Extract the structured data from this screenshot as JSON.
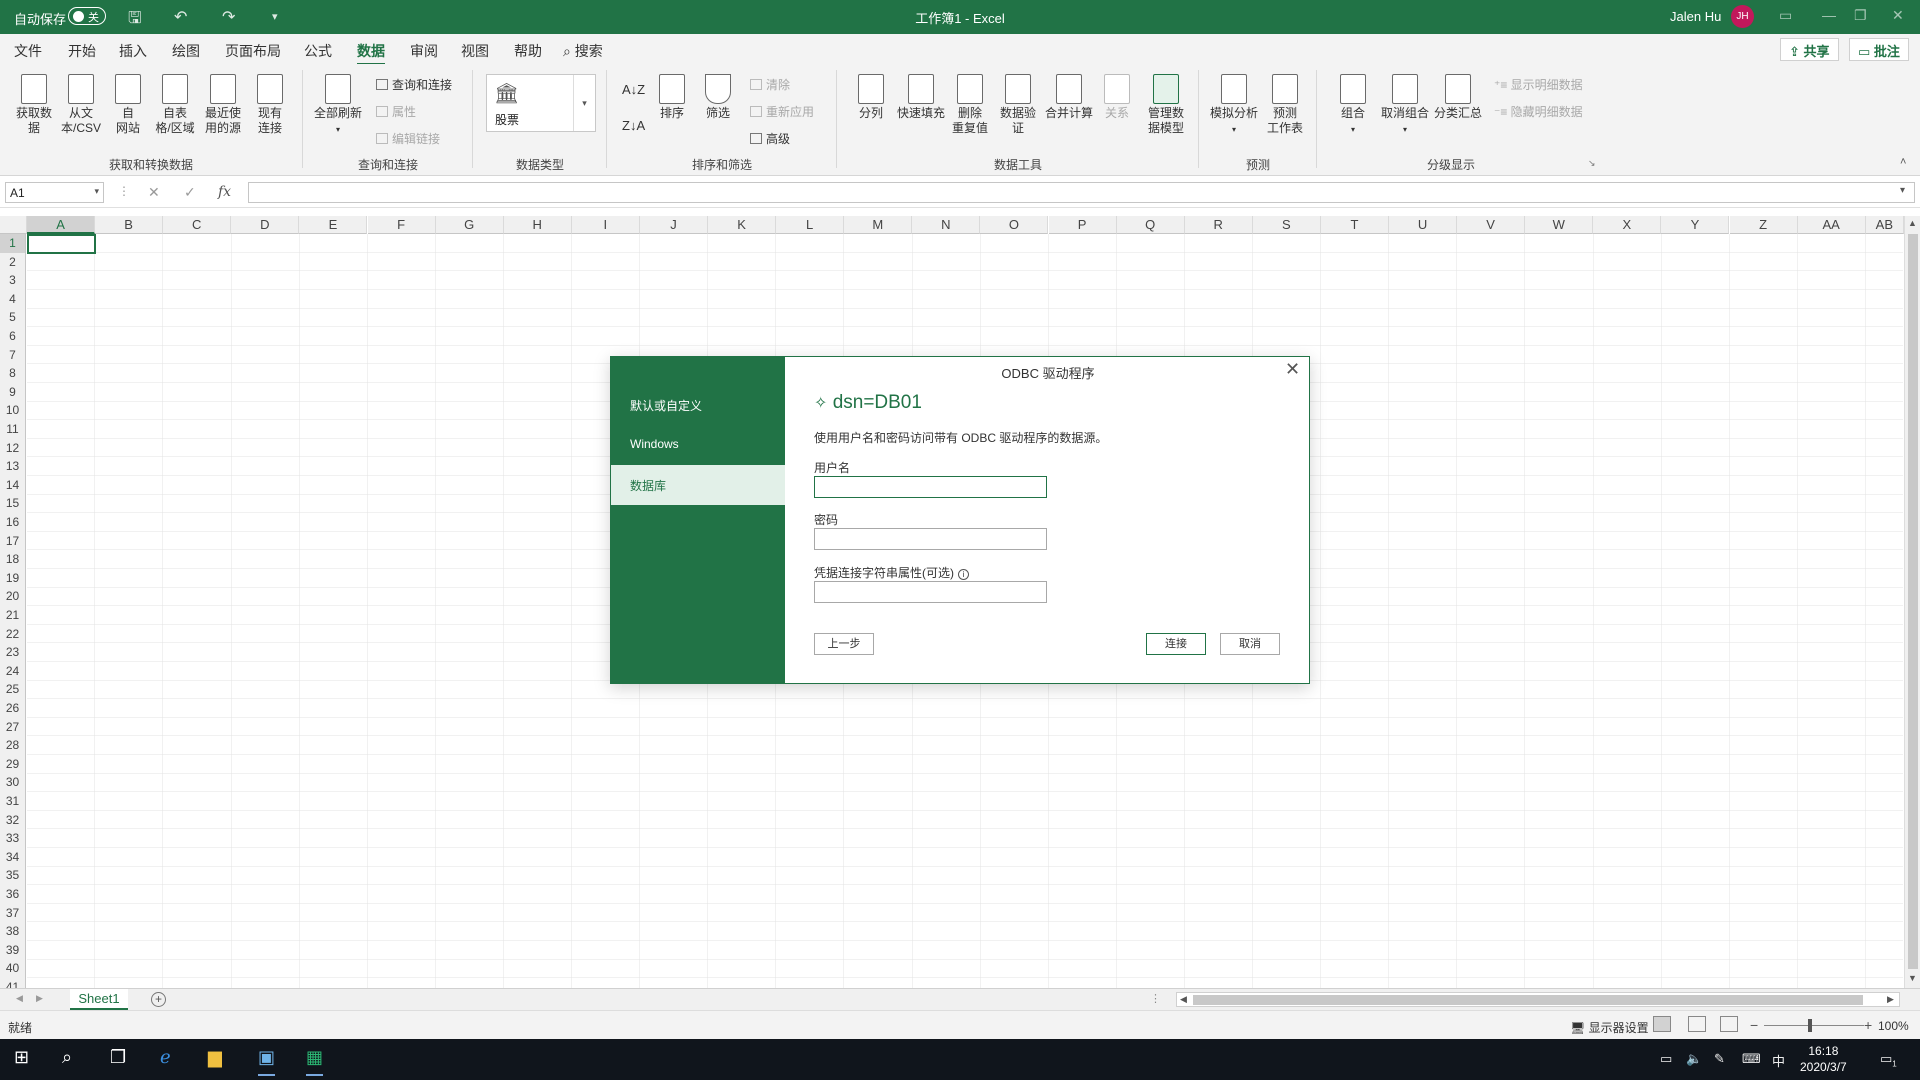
{
  "titlebar": {
    "autosave_label": "自动保存",
    "autosave_state": "关",
    "doc_title": "工作簿1  -  Excel",
    "user_name": "Jalen Hu",
    "avatar_initials": "JH"
  },
  "menu": {
    "items": [
      "文件",
      "开始",
      "插入",
      "绘图",
      "页面布局",
      "公式",
      "数据",
      "审阅",
      "视图",
      "帮助"
    ],
    "active": "数据",
    "search_label": "搜索",
    "share_label": "共享",
    "comment_label": "批注"
  },
  "ribbon": {
    "get_transform": {
      "buttons": [
        "获取数\n据",
        "从文\n本/CSV",
        "自\n网站",
        "自表\n格/区域",
        "最近使\n用的源",
        "现有\n连接"
      ],
      "group_label": "获取和转换数据"
    },
    "queries": {
      "refresh_all": "全部刷新",
      "queries_connections": "查询和连接",
      "properties": "属性",
      "edit_links": "编辑链接",
      "group_label": "查询和连接"
    },
    "data_types": {
      "stocks": "股票",
      "group_label": "数据类型"
    },
    "sort_filter": {
      "sort": "排序",
      "filter": "筛选",
      "clear": "清除",
      "reapply": "重新应用",
      "advanced": "高级",
      "group_label": "排序和筛选"
    },
    "data_tools": {
      "buttons": [
        "分列",
        "快速填充",
        "删除\n重复值",
        "数据验\n证",
        "合并计算",
        "关系",
        "管理数\n据模型"
      ],
      "group_label": "数据工具"
    },
    "forecast": {
      "buttons": [
        "模拟分析",
        "预测\n工作表"
      ],
      "group_label": "预测"
    },
    "outline": {
      "buttons": [
        "组合",
        "取消组合",
        "分类汇总"
      ],
      "show_detail": "显示明细数据",
      "hide_detail": "隐藏明细数据",
      "group_label": "分级显示"
    }
  },
  "formula_bar": {
    "name_box": "A1",
    "formula": ""
  },
  "grid": {
    "columns": [
      "A",
      "B",
      "C",
      "D",
      "E",
      "F",
      "G",
      "H",
      "I",
      "J",
      "K",
      "L",
      "M",
      "N",
      "O",
      "P",
      "Q",
      "R",
      "S",
      "T",
      "U",
      "V",
      "W",
      "X",
      "Y",
      "Z",
      "AA",
      "AB"
    ],
    "rows": [
      "1",
      "2",
      "3",
      "4",
      "5",
      "6",
      "7",
      "8",
      "9",
      "10",
      "11",
      "12",
      "13",
      "14",
      "15",
      "16",
      "17",
      "18",
      "19",
      "20",
      "21",
      "22",
      "23",
      "24",
      "25",
      "26",
      "27",
      "28",
      "29",
      "30",
      "31",
      "32",
      "33",
      "34",
      "35",
      "36",
      "37",
      "38",
      "39",
      "40",
      "41"
    ],
    "active_cell": "A1"
  },
  "sheets": {
    "tabs": [
      "Sheet1"
    ],
    "active": "Sheet1"
  },
  "status": {
    "ready": "就绪",
    "display_settings": "显示器设置",
    "zoom": "100%"
  },
  "taskbar": {
    "ime": "中",
    "time": "16:18",
    "date": "2020/3/7",
    "notifications": "1"
  },
  "dialog": {
    "title": "ODBC 驱动程序",
    "auth_options": [
      "默认或自定义",
      "Windows",
      "数据库"
    ],
    "selected_option": "数据库",
    "dsn": "dsn=DB01",
    "description": "使用用户名和密码访问带有 ODBC 驱动程序的数据源。",
    "username_label": "用户名",
    "username_value": "",
    "password_label": "密码",
    "password_value": "",
    "conn_props_label": "凭据连接字符串属性(可选)",
    "conn_props_value": "",
    "back_button": "上一步",
    "connect_button": "连接",
    "cancel_button": "取消"
  },
  "colors": {
    "excel_green": "#217346",
    "taskbar": "#10151c",
    "avatar": "#c2185b"
  }
}
